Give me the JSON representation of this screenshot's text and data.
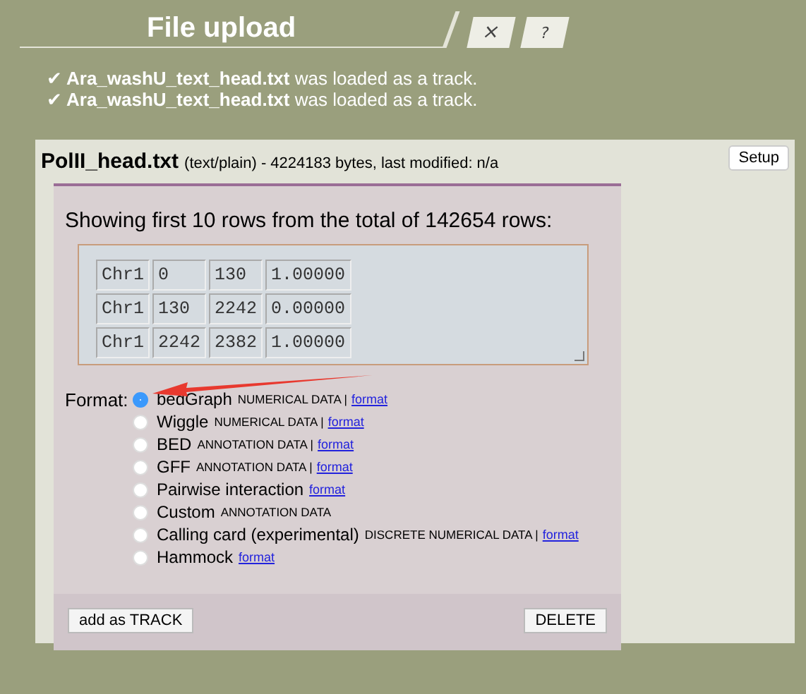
{
  "header": {
    "title": "File upload",
    "buttons": [
      {
        "kind": "close",
        "label": "×"
      },
      {
        "kind": "help",
        "label": "?"
      }
    ]
  },
  "messages": [
    {
      "icon": "✔",
      "file": "Ara_washU_text_head.txt",
      "text": "was loaded as a track."
    },
    {
      "icon": "✔",
      "file": "Ara_washU_text_head.txt",
      "text": "was loaded as a track."
    }
  ],
  "file": {
    "name": "PolII_head.txt",
    "info": "(text/plain) - 4224183 bytes, last modified: n/a",
    "setup_button": "Setup"
  },
  "preview": {
    "caption": "Showing first 10 rows from the total of 142654 rows:",
    "rows": [
      [
        "Chr1",
        "0",
        "130",
        "1.00000"
      ],
      [
        "Chr1",
        "130",
        "2242",
        "0.00000"
      ],
      [
        "Chr1",
        "2242",
        "2382",
        "1.00000"
      ]
    ]
  },
  "format": {
    "label": "Format:",
    "options": [
      {
        "name": "bedGraph",
        "type": "NUMERICAL DATA |",
        "link": "format",
        "selected": true
      },
      {
        "name": "Wiggle",
        "type": "NUMERICAL DATA |",
        "link": "format",
        "selected": false
      },
      {
        "name": "BED",
        "type": "ANNOTATION DATA |",
        "link": "format",
        "selected": false
      },
      {
        "name": "GFF",
        "type": "ANNOTATION DATA |",
        "link": "format",
        "selected": false
      },
      {
        "name": "Pairwise interaction",
        "link": "format",
        "selected": false
      },
      {
        "name": "Custom",
        "type": "ANNOTATION DATA",
        "selected": false
      },
      {
        "name": "Calling card (experimental)",
        "type": "DISCRETE NUMERICAL DATA |",
        "link": "format",
        "selected": false
      },
      {
        "name": "Hammock",
        "link": "format",
        "selected": false
      }
    ]
  },
  "footer": {
    "add_button": "add as TRACK",
    "delete_button": "DELETE"
  }
}
